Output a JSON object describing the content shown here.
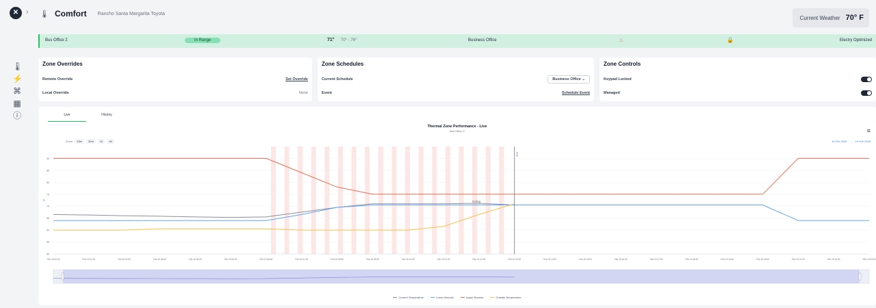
{
  "app": {
    "title": "Comfort",
    "breadcrumb": "Rancho Santa Margarita Toyota",
    "logo": "✕"
  },
  "weather": {
    "label": "Current Weather",
    "value": "70° F"
  },
  "zone": {
    "name": "Bus Office 2",
    "status": "In Range",
    "temp": "71°",
    "range": "70° - 76°",
    "schedule": "Business Office",
    "mode": "Electry Optimized"
  },
  "overrides": {
    "title": "Zone Overrides",
    "remote_label": "Remote Override",
    "remote_action": "Set Override",
    "local_label": "Local Override",
    "local_value": "None"
  },
  "schedules": {
    "title": "Zone Schedules",
    "current_label": "Current Schedule",
    "current_value": "Business Office",
    "event_label": "Event",
    "event_action": "Schedule Event"
  },
  "controls": {
    "title": "Zone Controls",
    "keypad_label": "Keypad Locked",
    "managed_label": "Managed"
  },
  "tabs": [
    "Live",
    "History"
  ],
  "chart_data": {
    "type": "line",
    "title": "Thermal Zone Performance - Live",
    "subtitle": "Bus Office 2",
    "ylabel": "°F",
    "ylim": [
      50,
      95
    ],
    "yticks": [
      50,
      55,
      60,
      65,
      70,
      75,
      80,
      85,
      90
    ],
    "zoom_label": "Zoom",
    "zoom_options": [
      "15m",
      "30m",
      "1h",
      "All"
    ],
    "range_from": "19 Feb 2026",
    "range_to": "19 Feb 2026",
    "x": [
      "Feb 19 00:00",
      "Feb 19 01:00",
      "Feb 19 02:00",
      "Feb 19 03:00",
      "Feb 19 04:00",
      "Feb 19 05:00",
      "Feb 19 06:00",
      "Feb 19 07:00",
      "Feb 19 08:00",
      "Feb 19 09:00",
      "Feb 19 10:00",
      "Feb 19 11:00",
      "Feb 19 12:00",
      "Feb 19 13:00",
      "Feb 19 14:00",
      "Feb 19 15:00",
      "Feb 19 16:00",
      "Feb 19 17:00",
      "Feb 19 18:00",
      "Feb 19 19:00",
      "Feb 19 20:00",
      "Feb 19 21:00",
      "Feb 19 22:00",
      "Feb 19 23:00"
    ],
    "now_label": "Now",
    "annotation": "Cooling",
    "series": [
      {
        "name": "Current Temperature",
        "color": "#8b8f99",
        "values": [
          66.5,
          66.3,
          66.0,
          65.8,
          65.5,
          65.3,
          65.5,
          67.5,
          69.5,
          71.0,
          71.0,
          71.0,
          71.2,
          70.5,
          null,
          null,
          null,
          null,
          null,
          null,
          null,
          null,
          null,
          null
        ]
      },
      {
        "name": "Lower Bounds",
        "color": "#60a5fa",
        "values": [
          64,
          64,
          64,
          64,
          64,
          64,
          64,
          66.5,
          69.5,
          70.5,
          70.5,
          70.5,
          70.5,
          70.5,
          70.5,
          70.5,
          70.5,
          70.5,
          70.5,
          70.5,
          70.5,
          64,
          64,
          64
        ]
      },
      {
        "name": "Upper Bounds",
        "color": "#ef6b4f",
        "values": [
          90,
          90,
          90,
          90,
          90,
          90,
          90,
          84,
          78,
          75,
          75,
          75,
          75,
          75,
          75,
          75,
          75,
          75,
          75,
          75,
          75,
          90,
          90,
          90
        ]
      },
      {
        "name": "Outside Temperature",
        "color": "#fbbf46",
        "values": [
          60,
          60,
          60,
          60.5,
          60.5,
          60.5,
          60.5,
          60,
          60,
          60,
          60,
          61.5,
          66.5,
          71,
          null,
          null,
          null,
          null,
          null,
          null,
          null,
          null,
          null,
          null
        ]
      }
    ]
  }
}
